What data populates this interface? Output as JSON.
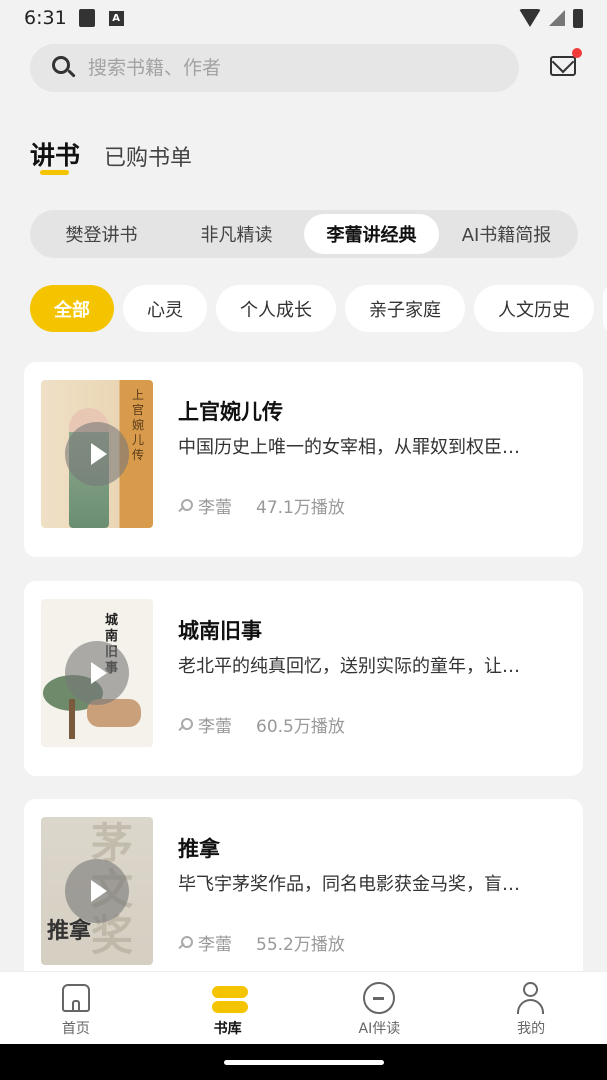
{
  "status_bar": {
    "time": "6:31",
    "a_badge": "A"
  },
  "search": {
    "placeholder": "搜索书籍、作者"
  },
  "main_tabs": [
    {
      "label": "讲书",
      "active": true
    },
    {
      "label": "已购书单",
      "active": false
    }
  ],
  "segments": [
    {
      "label": "樊登讲书",
      "active": false
    },
    {
      "label": "非凡精读",
      "active": false
    },
    {
      "label": "李蕾讲经典",
      "active": true
    },
    {
      "label": "AI书籍简报",
      "active": false
    }
  ],
  "chips": [
    {
      "label": "全部",
      "active": true
    },
    {
      "label": "心灵",
      "active": false
    },
    {
      "label": "个人成长",
      "active": false
    },
    {
      "label": "亲子家庭",
      "active": false
    },
    {
      "label": "人文历史",
      "active": false
    }
  ],
  "books": [
    {
      "title": "上官婉儿传",
      "desc": "中国历史上唯一的女宰相，从罪奴到权臣…",
      "narrator": "李蕾",
      "plays": "47.1万播放",
      "cover_text": "上官婉儿传"
    },
    {
      "title": "城南旧事",
      "desc": "老北平的纯真回忆，送别实际的童年，让…",
      "narrator": "李蕾",
      "plays": "60.5万播放",
      "cover_text": "城南旧事"
    },
    {
      "title": "推拿",
      "desc": "毕飞宇茅奖作品，同名电影获金马奖，盲…",
      "narrator": "李蕾",
      "plays": "55.2万播放",
      "cover_text": "推拿",
      "cover_ghost": "茅文奖"
    }
  ],
  "bottom_nav": [
    {
      "label": "首页",
      "icon": "home-icon",
      "active": false
    },
    {
      "label": "书库",
      "icon": "library-icon",
      "active": true
    },
    {
      "label": "AI伴读",
      "icon": "chat-icon",
      "active": false
    },
    {
      "label": "我的",
      "icon": "person-icon",
      "active": false
    }
  ],
  "colors": {
    "accent": "#f5c400",
    "badge": "#f23a3a",
    "background": "#f2f2f2"
  }
}
